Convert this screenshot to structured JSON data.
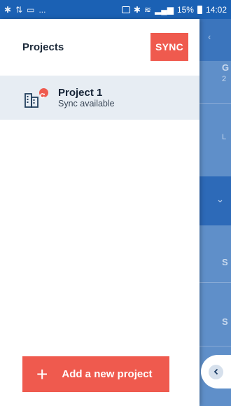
{
  "status_bar": {
    "left_text": "...",
    "battery_percent": "15%",
    "time": "14:02"
  },
  "drawer": {
    "title": "Projects",
    "sync_label": "SYNC",
    "projects": [
      {
        "name": "Project 1",
        "status": "Sync available"
      }
    ],
    "add_label": "Add a new project",
    "add_icon": "plus-icon"
  },
  "background": {
    "letters": [
      "G",
      "2",
      "L",
      "S",
      "S"
    ]
  },
  "colors": {
    "accent": "#ef5a4e",
    "header_blue": "#1b61b4",
    "selected_row": "#e7edf3"
  }
}
